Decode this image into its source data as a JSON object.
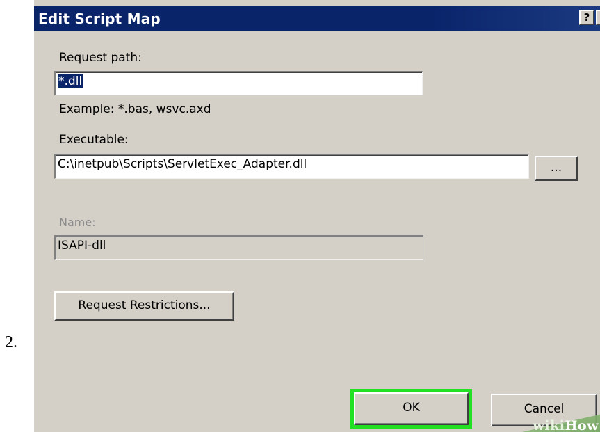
{
  "step": {
    "number": "2."
  },
  "dialog": {
    "title": "Edit Script Map",
    "help_button": "?",
    "close_button": "×",
    "request_path": {
      "label": "Request path:",
      "value": "*.dll",
      "example": "Example: *.bas, wsvc.axd"
    },
    "executable": {
      "label": "Executable:",
      "value": "C:\\inetpub\\Scripts\\ServletExec_Adapter.dll",
      "browse_label": "..."
    },
    "name": {
      "label": "Name:",
      "value": "ISAPI-dll"
    },
    "request_restrictions_label": "Request Restrictions...",
    "ok_label": "OK",
    "cancel_label": "Cancel"
  },
  "watermark": {
    "text_a": "wiki",
    "text_b": "How"
  },
  "colors": {
    "titlebar": "#0a246a",
    "dialog_bg": "#d4d0c8",
    "highlight": "#22e022",
    "selection": "#0a246a"
  }
}
